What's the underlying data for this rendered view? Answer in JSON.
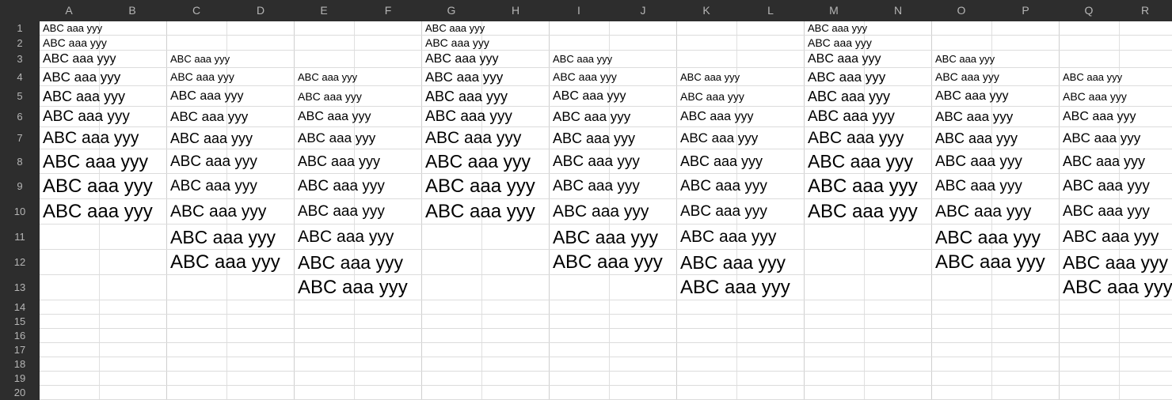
{
  "columns": [
    "A",
    "B",
    "C",
    "D",
    "E",
    "F",
    "G",
    "H",
    "I",
    "J",
    "K",
    "L",
    "M",
    "N",
    "O",
    "P",
    "Q",
    "R"
  ],
  "rows": [
    "1",
    "2",
    "3",
    "4",
    "5",
    "6",
    "7",
    "8",
    "9",
    "10",
    "11",
    "12",
    "13",
    "14",
    "15",
    "16",
    "17",
    "18",
    "19",
    "20"
  ],
  "cell_text": "ABC aaa yyy",
  "colors": {
    "header_bg": "#2d2d2d",
    "header_text": "#b5b5b5",
    "gridline": "#dcdcdc",
    "cell_text": "#000000"
  },
  "cells": [
    {
      "group": 0,
      "row": 1,
      "size": 13
    },
    {
      "group": 0,
      "row": 2,
      "size": 14
    },
    {
      "group": 0,
      "row": 3,
      "size": 16
    },
    {
      "group": 0,
      "row": 4,
      "size": 17
    },
    {
      "group": 0,
      "row": 5,
      "size": 18
    },
    {
      "group": 0,
      "row": 6,
      "size": 19
    },
    {
      "group": 0,
      "row": 7,
      "size": 21
    },
    {
      "group": 0,
      "row": 8,
      "size": 23
    },
    {
      "group": 0,
      "row": 9,
      "size": 24
    },
    {
      "group": 0,
      "row": 10,
      "size": 24
    },
    {
      "group": 1,
      "row": 3,
      "size": 13
    },
    {
      "group": 1,
      "row": 4,
      "size": 14
    },
    {
      "group": 1,
      "row": 5,
      "size": 16
    },
    {
      "group": 1,
      "row": 6,
      "size": 17
    },
    {
      "group": 1,
      "row": 7,
      "size": 18
    },
    {
      "group": 1,
      "row": 8,
      "size": 19
    },
    {
      "group": 1,
      "row": 9,
      "size": 19
    },
    {
      "group": 1,
      "row": 10,
      "size": 21
    },
    {
      "group": 1,
      "row": 11,
      "size": 23
    },
    {
      "group": 1,
      "row": 12,
      "size": 24
    },
    {
      "group": 2,
      "row": 4,
      "size": 13
    },
    {
      "group": 2,
      "row": 5,
      "size": 14
    },
    {
      "group": 2,
      "row": 6,
      "size": 16
    },
    {
      "group": 2,
      "row": 7,
      "size": 17
    },
    {
      "group": 2,
      "row": 8,
      "size": 18
    },
    {
      "group": 2,
      "row": 9,
      "size": 19
    },
    {
      "group": 2,
      "row": 10,
      "size": 19
    },
    {
      "group": 2,
      "row": 11,
      "size": 21
    },
    {
      "group": 2,
      "row": 12,
      "size": 23
    },
    {
      "group": 2,
      "row": 13,
      "size": 24
    },
    {
      "group": 3,
      "row": 1,
      "size": 13
    },
    {
      "group": 3,
      "row": 2,
      "size": 14
    },
    {
      "group": 3,
      "row": 3,
      "size": 16
    },
    {
      "group": 3,
      "row": 4,
      "size": 17
    },
    {
      "group": 3,
      "row": 5,
      "size": 18
    },
    {
      "group": 3,
      "row": 6,
      "size": 19
    },
    {
      "group": 3,
      "row": 7,
      "size": 21
    },
    {
      "group": 3,
      "row": 8,
      "size": 23
    },
    {
      "group": 3,
      "row": 9,
      "size": 24
    },
    {
      "group": 3,
      "row": 10,
      "size": 24
    },
    {
      "group": 4,
      "row": 3,
      "size": 13
    },
    {
      "group": 4,
      "row": 4,
      "size": 14
    },
    {
      "group": 4,
      "row": 5,
      "size": 16
    },
    {
      "group": 4,
      "row": 6,
      "size": 17
    },
    {
      "group": 4,
      "row": 7,
      "size": 18
    },
    {
      "group": 4,
      "row": 8,
      "size": 19
    },
    {
      "group": 4,
      "row": 9,
      "size": 19
    },
    {
      "group": 4,
      "row": 10,
      "size": 21
    },
    {
      "group": 4,
      "row": 11,
      "size": 23
    },
    {
      "group": 4,
      "row": 12,
      "size": 24
    },
    {
      "group": 5,
      "row": 4,
      "size": 13
    },
    {
      "group": 5,
      "row": 5,
      "size": 14
    },
    {
      "group": 5,
      "row": 6,
      "size": 16
    },
    {
      "group": 5,
      "row": 7,
      "size": 17
    },
    {
      "group": 5,
      "row": 8,
      "size": 18
    },
    {
      "group": 5,
      "row": 9,
      "size": 19
    },
    {
      "group": 5,
      "row": 10,
      "size": 19
    },
    {
      "group": 5,
      "row": 11,
      "size": 21
    },
    {
      "group": 5,
      "row": 12,
      "size": 23
    },
    {
      "group": 5,
      "row": 13,
      "size": 24
    },
    {
      "group": 6,
      "row": 1,
      "size": 13
    },
    {
      "group": 6,
      "row": 2,
      "size": 14
    },
    {
      "group": 6,
      "row": 3,
      "size": 16
    },
    {
      "group": 6,
      "row": 4,
      "size": 17
    },
    {
      "group": 6,
      "row": 5,
      "size": 18
    },
    {
      "group": 6,
      "row": 6,
      "size": 19
    },
    {
      "group": 6,
      "row": 7,
      "size": 21
    },
    {
      "group": 6,
      "row": 8,
      "size": 23
    },
    {
      "group": 6,
      "row": 9,
      "size": 24
    },
    {
      "group": 6,
      "row": 10,
      "size": 24
    },
    {
      "group": 7,
      "row": 3,
      "size": 13
    },
    {
      "group": 7,
      "row": 4,
      "size": 14
    },
    {
      "group": 7,
      "row": 5,
      "size": 16
    },
    {
      "group": 7,
      "row": 6,
      "size": 17
    },
    {
      "group": 7,
      "row": 7,
      "size": 18
    },
    {
      "group": 7,
      "row": 8,
      "size": 19
    },
    {
      "group": 7,
      "row": 9,
      "size": 19
    },
    {
      "group": 7,
      "row": 10,
      "size": 21
    },
    {
      "group": 7,
      "row": 11,
      "size": 23
    },
    {
      "group": 7,
      "row": 12,
      "size": 24
    },
    {
      "group": 8,
      "row": 4,
      "size": 13
    },
    {
      "group": 8,
      "row": 5,
      "size": 14
    },
    {
      "group": 8,
      "row": 6,
      "size": 16
    },
    {
      "group": 8,
      "row": 7,
      "size": 17
    },
    {
      "group": 8,
      "row": 8,
      "size": 18
    },
    {
      "group": 8,
      "row": 9,
      "size": 19
    },
    {
      "group": 8,
      "row": 10,
      "size": 19
    },
    {
      "group": 8,
      "row": 11,
      "size": 21
    },
    {
      "group": 8,
      "row": 12,
      "size": 23
    },
    {
      "group": 8,
      "row": 13,
      "size": 24
    }
  ]
}
